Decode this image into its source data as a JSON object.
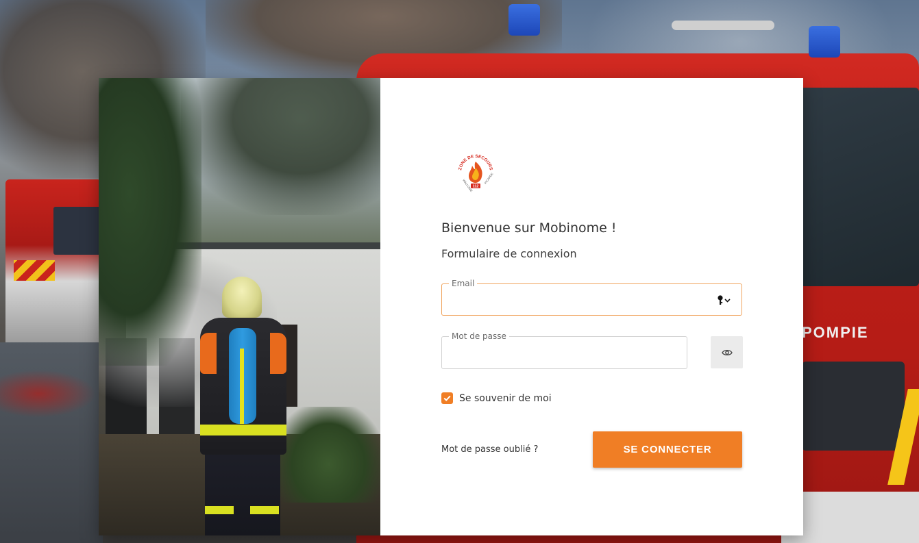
{
  "logo": {
    "top_text": "ZONE DE SECOURS",
    "left_text": "WALLONIE",
    "right_text": "PICARDE",
    "number": "112"
  },
  "form": {
    "welcome": "Bienvenue sur Mobinome !",
    "subtitle": "Formulaire de connexion",
    "email": {
      "label": "Email",
      "value": "",
      "placeholder": ""
    },
    "password": {
      "label": "Mot de passe",
      "value": "",
      "placeholder": ""
    },
    "remember": {
      "label": "Se souvenir de moi",
      "checked": true
    },
    "forgot_link": "Mot de passe oublié ?",
    "submit_label": "SE CONNECTER"
  },
  "background_label": "POMPIE",
  "colors": {
    "accent": "#f07e25",
    "focused_border": "#f0a25a",
    "card_background": "#ffffff"
  },
  "icons": {
    "email_field": "key-icon",
    "password_toggle": "eye-icon",
    "checkbox": "checkmark-icon"
  }
}
